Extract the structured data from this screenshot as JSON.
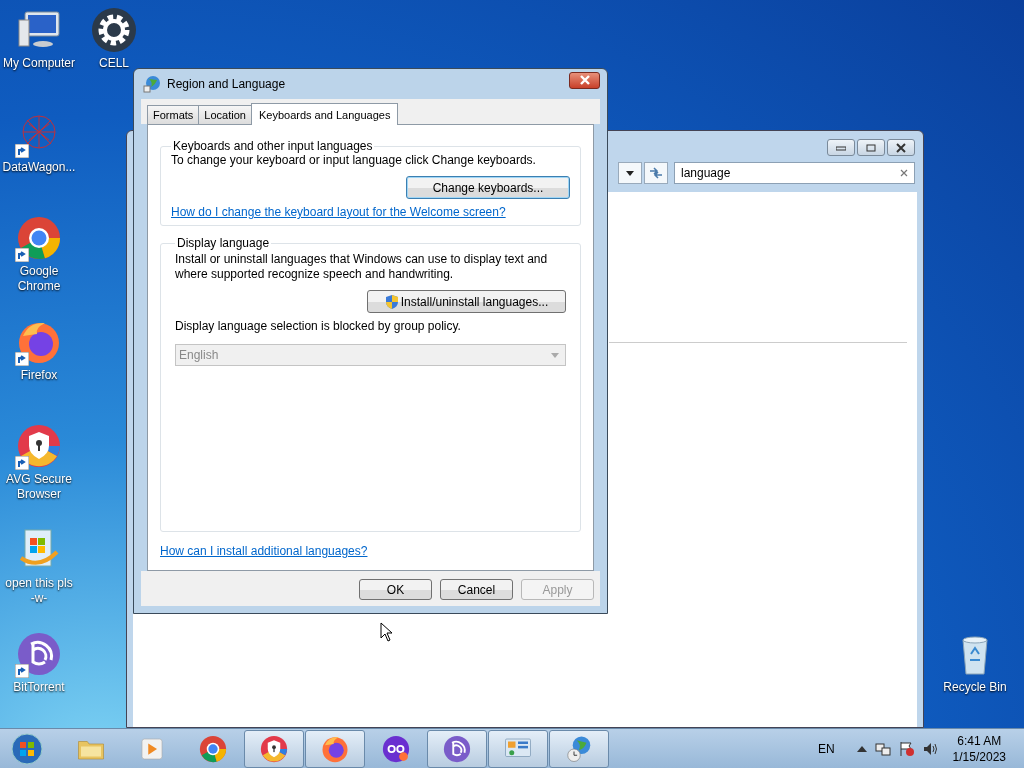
{
  "desktop_icons": [
    {
      "kind": "computer",
      "label": "My Computer",
      "shortcut": false
    },
    {
      "kind": "gear",
      "label": "CELL",
      "shortcut": false
    },
    {
      "kind": "network",
      "label": "DataWagon...",
      "shortcut": true
    },
    {
      "kind": "chrome",
      "label": "Google Chrome",
      "shortcut": true
    },
    {
      "kind": "firefox",
      "label": "Firefox",
      "shortcut": true
    },
    {
      "kind": "avg",
      "label": "AVG Secure Browser",
      "shortcut": true
    },
    {
      "kind": "installer",
      "label": "open this pls -w-",
      "shortcut": false
    },
    {
      "kind": "bittorrent",
      "label": "BitTorrent",
      "shortcut": true
    },
    {
      "kind": "recycle",
      "label": "Recycle Bin",
      "shortcut": false
    }
  ],
  "background_window": {
    "search": {
      "value": "language"
    }
  },
  "dialog": {
    "title": "Region and Language",
    "tabs": [
      {
        "label": "Formats",
        "selected": false
      },
      {
        "label": "Location",
        "selected": false
      },
      {
        "label": "Keyboards and Languages",
        "selected": true
      }
    ],
    "keyboards_group": {
      "title": "Keyboards and other input languages",
      "text": "To change your keyboard or input language click Change keyboards.",
      "button": "Change keyboards...",
      "link": "How do I change the keyboard layout for the Welcome screen?"
    },
    "display_group": {
      "title": "Display language",
      "text": "Install or uninstall languages that Windows can use to display text and where supported recognize speech and handwriting.",
      "button": "Install/uninstall languages...",
      "policy_text": "Display language selection is blocked by group policy.",
      "dropdown": {
        "value": "English",
        "disabled": true
      }
    },
    "link": "How can I install additional languages?",
    "buttons": [
      {
        "label": "OK",
        "disabled": false
      },
      {
        "label": "Cancel",
        "disabled": false
      },
      {
        "label": "Apply",
        "disabled": true
      }
    ]
  },
  "taskbar": {
    "items": [
      {
        "kind": "explorer",
        "running": false
      },
      {
        "kind": "media",
        "running": false
      },
      {
        "kind": "chrome",
        "running": false
      },
      {
        "kind": "avg",
        "running": true
      },
      {
        "kind": "firefox",
        "running": true
      },
      {
        "kind": "incognito",
        "running": false
      },
      {
        "kind": "bittorrent",
        "running": true
      },
      {
        "kind": "control",
        "running": true
      },
      {
        "kind": "globe",
        "running": true
      }
    ],
    "language": "EN",
    "time": "6:41 AM",
    "date": "1/15/2023"
  }
}
